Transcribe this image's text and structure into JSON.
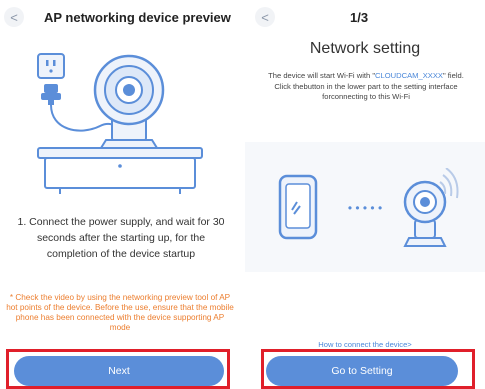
{
  "left": {
    "back_label": "<",
    "title": "AP networking device preview",
    "instruction": "1. Connect the power supply, and wait for 30 seconds after the starting up, for the completion of the device startup",
    "warning": "* Check the video by using the networking preview tool of AP hot points of the device. Before the use, ensure that the mobile phone has been connected with the device supporting AP mode",
    "button_label": "Next"
  },
  "right": {
    "back_label": "<",
    "step": "1/3",
    "title": "Network setting",
    "desc_prefix": "The device will start Wi-Fi with \"",
    "desc_ssid": "CLOUDCAM_XXXX",
    "desc_suffix": "\" field. Click thebutton in the lower part to the setting interface forconnecting to this Wi-Fi",
    "dots": "• • • • •",
    "help_link": "How to connect the device>",
    "button_label": "Go to Setting"
  },
  "colors": {
    "accent": "#5b8ed9",
    "link": "#4a87d9",
    "warning": "#ec7e2f",
    "highlight": "#e01f2a"
  },
  "icons": {
    "left_illustration": "camera-with-power-plug-illustration",
    "right_illustration": "phone-to-camera-wifi-illustration"
  }
}
